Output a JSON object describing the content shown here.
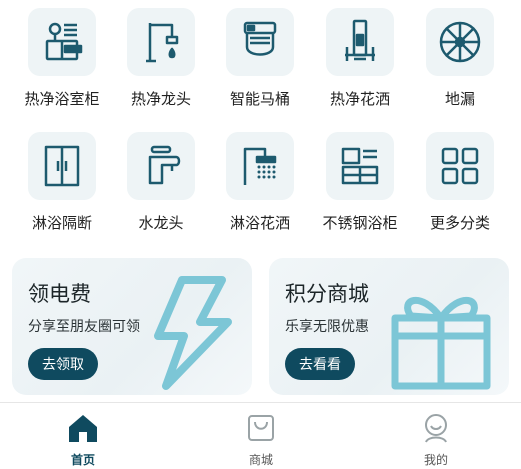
{
  "categories": [
    {
      "label": "热净浴室柜",
      "icon": "bathroom-cabinet-icon"
    },
    {
      "label": "热净龙头",
      "icon": "hot-faucet-icon"
    },
    {
      "label": "智能马桶",
      "icon": "smart-toilet-icon"
    },
    {
      "label": "热净花洒",
      "icon": "shower-set-icon"
    },
    {
      "label": "地漏",
      "icon": "floor-drain-icon"
    },
    {
      "label": "淋浴隔断",
      "icon": "shower-partition-icon"
    },
    {
      "label": "水龙头",
      "icon": "faucet-icon"
    },
    {
      "label": "淋浴花洒",
      "icon": "shower-head-icon"
    },
    {
      "label": "不锈钢浴柜",
      "icon": "steel-cabinet-icon"
    },
    {
      "label": "更多分类",
      "icon": "more-categories-icon"
    }
  ],
  "promos": {
    "electricity": {
      "title": "领电费",
      "subtitle": "分享至朋友圈可领",
      "button": "去领取",
      "icon": "lightning-icon"
    },
    "points": {
      "title": "积分商城",
      "subtitle": "乐享无限优惠",
      "button": "去看看",
      "icon": "gift-icon"
    }
  },
  "tabbar": {
    "home": {
      "label": "首页",
      "icon": "home-icon",
      "active": true
    },
    "mall": {
      "label": "商城",
      "icon": "shopping-bag-icon"
    },
    "mine": {
      "label": "我的",
      "icon": "user-icon"
    }
  },
  "colors": {
    "accent": "#0f4a5f",
    "icon": "#1d5a6e",
    "tile": "#eef4f6",
    "promo_art": "#7cc6d6"
  }
}
